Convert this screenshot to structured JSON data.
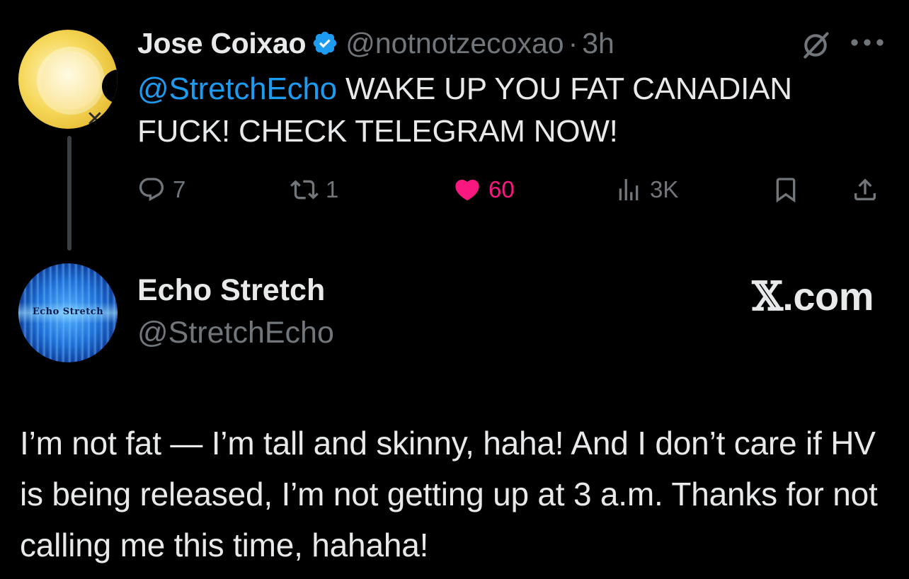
{
  "tweet1": {
    "author_name": "Jose Coixao",
    "verified": true,
    "handle": "@notnotzecoxao",
    "separator": "·",
    "time": "3h",
    "mention": "@StretchEcho",
    "body": " WAKE UP YOU FAT CANADIAN FUCK! CHECK TELEGRAM NOW!",
    "actions": {
      "replies": "7",
      "reposts": "1",
      "likes": "60",
      "views": "3K"
    },
    "icons": [
      "grok-icon",
      "more-icon",
      "reply-icon",
      "repost-icon",
      "like-icon",
      "views-icon",
      "bookmark-icon",
      "share-icon"
    ],
    "colors": {
      "mention": "#1d9bf0",
      "like": "#f91880",
      "verified": "#1d9bf0"
    }
  },
  "tweet2": {
    "author_name": "Echo Stretch",
    "handle": "@StretchEcho",
    "avatar_text": "Echo Stretch",
    "brand": ".com",
    "brand_mark": "𝕏",
    "body": "I’m not fat — I’m tall and skinny, haha! And I don’t care if HV is being released, I’m not getting up at 3 a.m. Thanks for not calling me this time, hahaha!"
  }
}
